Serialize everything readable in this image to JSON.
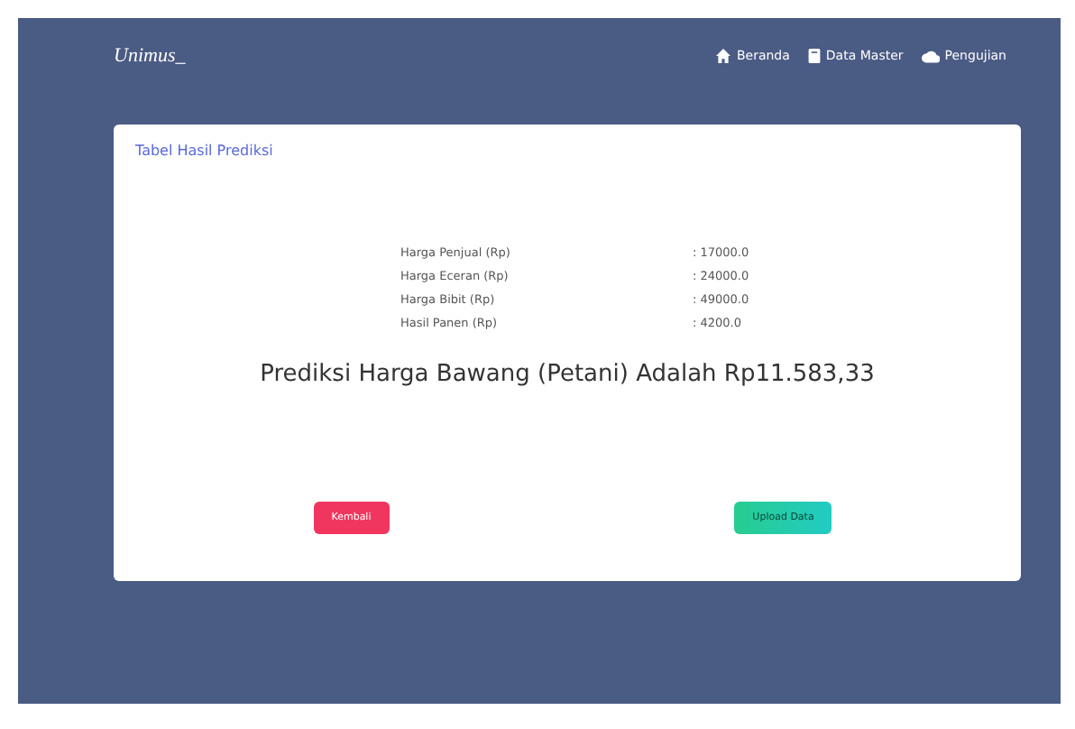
{
  "brand": "Unimus_",
  "nav": [
    {
      "label": "Beranda"
    },
    {
      "label": "Data Master"
    },
    {
      "label": "Pengujian"
    }
  ],
  "card": {
    "title": "Tabel Hasil Prediksi",
    "rows": [
      {
        "label": "Harga Penjual (Rp)",
        "value": ": 17000.0"
      },
      {
        "label": "Harga Eceran (Rp)",
        "value": ": 24000.0"
      },
      {
        "label": "Harga Bibit (Rp)",
        "value": ": 49000.0"
      },
      {
        "label": "Hasil Panen (Rp)",
        "value": ": 4200.0"
      }
    ],
    "result": "Prediksi Harga Bawang (Petani) Adalah Rp11.583,33",
    "buttons": [
      {
        "label": "Kembali",
        "kind": "danger"
      },
      {
        "label": "Upload Data",
        "kind": "success"
      }
    ]
  }
}
